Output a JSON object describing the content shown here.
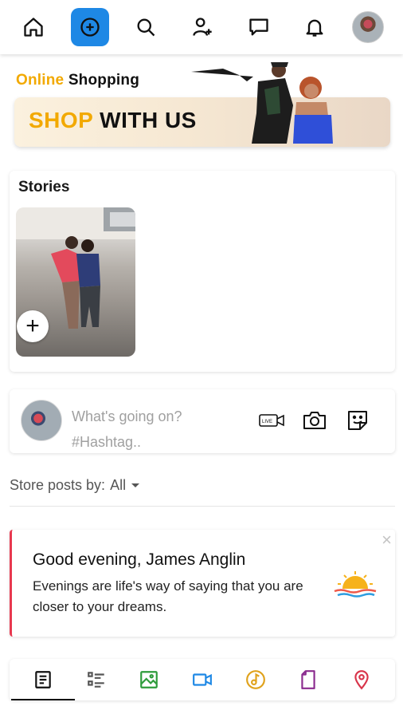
{
  "nav": {
    "icons": [
      "home-icon",
      "add-circle-icon",
      "search-icon",
      "add-friend-icon",
      "chat-icon",
      "bell-icon",
      "profile-avatar"
    ],
    "active_color": "#1e88e5"
  },
  "banner": {
    "online": "Online",
    "shopping": "Shopping",
    "shop": "SHOP",
    "with_us": "WITH US",
    "accent_color": "#f2a900"
  },
  "stories": {
    "title": "Stories",
    "add_symbol": "+"
  },
  "composer": {
    "placeholder_line1": "What's going on?",
    "placeholder_line2": "#Hashtag..",
    "icons": [
      "live-video-icon",
      "camera-icon",
      "sticker-icon"
    ]
  },
  "filter": {
    "label": "Store posts by:",
    "value": "All"
  },
  "greeting": {
    "title": "Good evening, James Anglin",
    "message": "Evenings are life's way of saying that you are closer to your dreams.",
    "close": "×",
    "accent_color": "#e8384f"
  },
  "tabs": {
    "items": [
      "posts-tab",
      "list-tab",
      "photos-tab",
      "videos-tab",
      "music-tab",
      "files-tab",
      "location-tab"
    ],
    "active_index": 0
  }
}
